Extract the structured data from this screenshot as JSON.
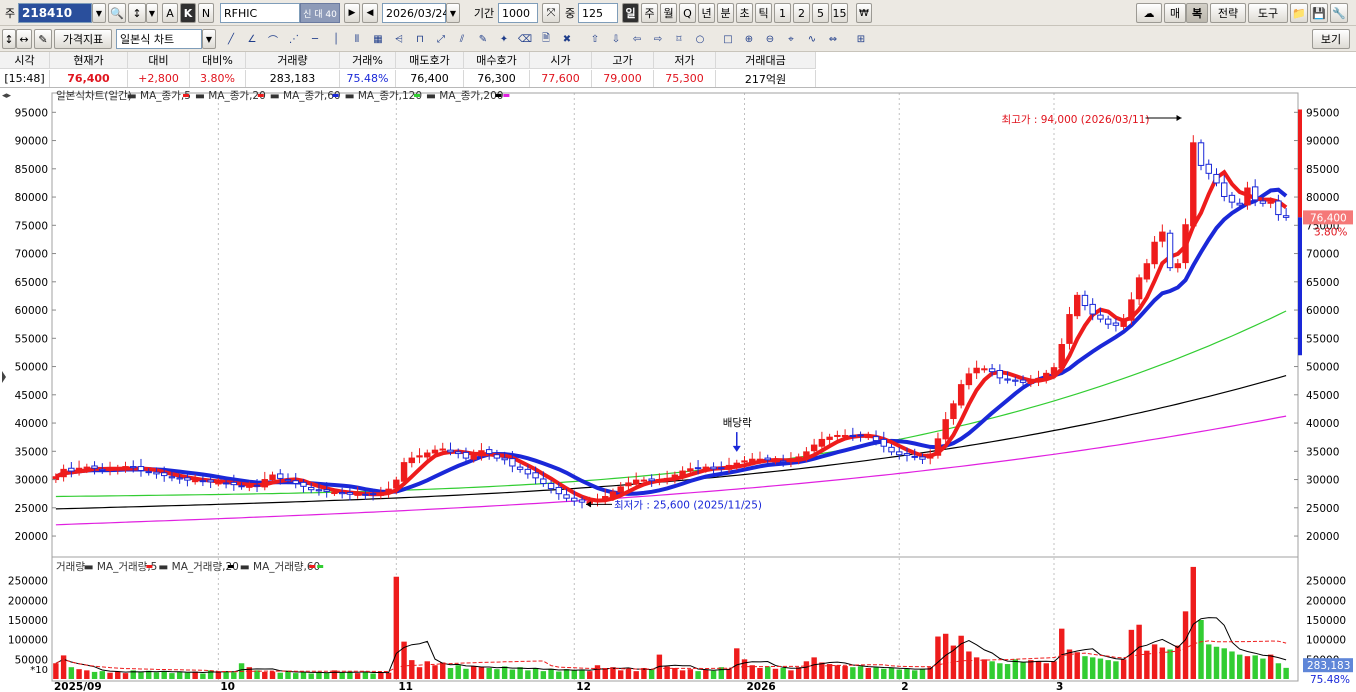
{
  "toolbar1": {
    "prefix": "주",
    "code": "218410",
    "name": "RFHIC",
    "name_tags": "신 대 40",
    "date": "2026/03/24",
    "period_label": "기간",
    "period_value": "1000",
    "zoom_label": "중",
    "zoom_value": "125",
    "ak_a": "A",
    "ak_k": "K",
    "ak_n": "N",
    "timeframes": [
      "일",
      "주",
      "월",
      "Q",
      "년",
      "분",
      "초",
      "틱",
      "1",
      "2",
      "5",
      "15"
    ],
    "active_timeframe": "일",
    "right_buttons": [
      "매",
      "복",
      "전략",
      "도구"
    ]
  },
  "toolbar2": {
    "indicator_button": "가격지표",
    "chart_type": "일본식 차트",
    "view_button": "보기"
  },
  "quote": {
    "headers": [
      "시각",
      "현재가",
      "대비",
      "대비%",
      "거래량",
      "거래%",
      "매도호가",
      "매수호가",
      "시가",
      "고가",
      "저가",
      "거래대금"
    ],
    "values": [
      "[15:48]",
      "76,400",
      "+2,800",
      "3.80%",
      "283,183",
      "75.48%",
      "76,400",
      "76,300",
      "77,600",
      "79,000",
      "75,300",
      "217억원"
    ]
  },
  "price_legend": {
    "title": "일본식차트(일간)",
    "items": [
      {
        "label": "MA_종가,5",
        "color": "#ee1c1c"
      },
      {
        "label": "MA_종가,20",
        "color": "#ee1c1c"
      },
      {
        "label": "MA_종가,60",
        "color": "#1a28d8"
      },
      {
        "label": "MA_종가,120",
        "color": "#32cd32"
      },
      {
        "label": "MA_종가,200",
        "color": "#000000"
      },
      {
        "label": "",
        "color": "#e020e0"
      }
    ]
  },
  "volume_legend": {
    "title": "거래량",
    "items": [
      {
        "label": "MA_거래량,5",
        "color": "#ee1c1c"
      },
      {
        "label": "MA_거래량,20",
        "color": "#000000"
      },
      {
        "label": "MA_거래량,60",
        "color": "#ee1c1c"
      },
      {
        "label": "",
        "color": "#32cd32"
      }
    ]
  },
  "annotations": {
    "high": "최고가 : 94,000 (2026/03/11)",
    "low": "최저가 : 25,600 (2025/11/25)",
    "dividend": "배당락"
  },
  "current_price_tag": "76,400",
  "current_pct_tag": "3.80%",
  "current_volume_tag": "283,183",
  "current_volume_pct_tag": "75.48%",
  "volume_unit": "*10",
  "colors": {
    "up": "#ee1c1c",
    "down": "#1a28d8",
    "ma120": "#32cd32",
    "ma200": "#000000",
    "ma_extra": "#e020e0"
  },
  "chart_data": {
    "type": "candlestick",
    "x_ticks": [
      "2025/09",
      "10",
      "11",
      "12",
      "2026",
      "2",
      "3"
    ],
    "y_ticks": [
      20000,
      25000,
      30000,
      35000,
      40000,
      45000,
      50000,
      55000,
      60000,
      65000,
      70000,
      75000,
      80000,
      85000,
      90000,
      95000
    ],
    "ylim": [
      17000,
      97000
    ],
    "vol_ticks": [
      50000,
      100000,
      150000,
      200000,
      250000
    ],
    "vol_ylim": [
      0,
      300000
    ],
    "close": [
      30500,
      31800,
      31500,
      32000,
      32200,
      32000,
      31600,
      31800,
      32000,
      32300,
      32100,
      31600,
      31300,
      31000,
      30700,
      30300,
      30100,
      29900,
      29800,
      29700,
      29600,
      29400,
      29300,
      29100,
      28800,
      28800,
      28900,
      30000,
      30800,
      30200,
      29800,
      29300,
      28800,
      28200,
      28000,
      27900,
      27700,
      27500,
      27400,
      27400,
      27300,
      27400,
      27600,
      28300,
      29900,
      33000,
      33800,
      34200,
      34700,
      35200,
      35400,
      34900,
      34600,
      33800,
      34200,
      35100,
      34600,
      33800,
      33500,
      32400,
      31800,
      31000,
      30300,
      29300,
      28400,
      27500,
      26700,
      26200,
      26000,
      26100,
      26400,
      27000,
      27800,
      28700,
      29400,
      29900,
      29900,
      29800,
      30000,
      30200,
      30800,
      31500,
      31900,
      32000,
      32200,
      31900,
      32000,
      32500,
      32900,
      33300,
      33600,
      33600,
      33500,
      33300,
      33100,
      33500,
      34000,
      34900,
      36100,
      37100,
      37500,
      37800,
      37800,
      37700,
      37800,
      37600,
      36900,
      35900,
      34900,
      34400,
      34300,
      34000,
      33600,
      34500,
      37200,
      40600,
      43400,
      46800,
      48700,
      49700,
      49600,
      49100,
      48000,
      47600,
      47400,
      47200,
      47400,
      47900,
      48800,
      49800,
      53900,
      59200,
      62600,
      60800,
      59300,
      58400,
      57500,
      57300,
      58200,
      61800,
      65700,
      68200,
      72000,
      73800,
      67500,
      68200,
      75100,
      89600,
      85600,
      84200,
      82500,
      80100,
      79100,
      78600,
      81600,
      79500,
      78900,
      79100,
      76900,
      76400
    ],
    "ma5_note": "derived in script from close",
    "volume": [
      40000,
      60000,
      30000,
      25000,
      22000,
      18000,
      20000,
      16000,
      19000,
      15000,
      22000,
      18000,
      21000,
      17000,
      20000,
      15000,
      18000,
      16000,
      19000,
      14000,
      22000,
      18000,
      20000,
      17000,
      40000,
      30000,
      22000,
      18000,
      19000,
      16000,
      21000,
      15000,
      18000,
      14000,
      17000,
      15000,
      22000,
      16000,
      18000,
      15000,
      19000,
      14000,
      17000,
      16000,
      260000,
      95000,
      48000,
      30000,
      45000,
      35000,
      42000,
      28000,
      35000,
      26000,
      33000,
      30000,
      28000,
      25000,
      32000,
      24000,
      30000,
      22000,
      28000,
      20000,
      26000,
      19000,
      25000,
      22000,
      24000,
      20000,
      35000,
      28000,
      30000,
      22000,
      26000,
      20000,
      28000,
      24000,
      62000,
      32000,
      28000,
      22000,
      25000,
      20000,
      24000,
      21000,
      30000,
      26000,
      78000,
      50000,
      35000,
      28000,
      32000,
      26000,
      28000,
      22000,
      30000,
      45000,
      55000,
      42000,
      38000,
      35000,
      33000,
      30000,
      32000,
      28000,
      30000,
      26000,
      28000,
      24000,
      26000,
      22000,
      26000,
      30000,
      108000,
      115000,
      85000,
      110000,
      70000,
      55000,
      50000,
      45000,
      40000,
      38000,
      50000,
      42000,
      48000,
      46000,
      40000,
      45000,
      128000,
      75000,
      68000,
      58000,
      55000,
      52000,
      48000,
      45000,
      50000,
      125000,
      138000,
      72000,
      88000,
      80000,
      75000,
      85000,
      172000,
      285000,
      150000,
      88000,
      82000,
      78000,
      70000,
      62000,
      58000,
      60000,
      52000,
      62000,
      40000,
      28300
    ]
  }
}
